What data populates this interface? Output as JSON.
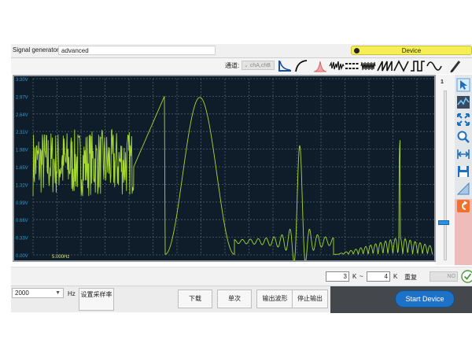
{
  "header": {
    "title": "Signal generator",
    "mode_value": "advanced",
    "device_label": "Device"
  },
  "toolbar": {
    "channel_label": "通道:",
    "channel_value": "chA,chB",
    "wave_buttons": [
      "log-curve-icon",
      "sqrt-curve-icon",
      "gaussian-pulse-icon",
      "noise-icon",
      "pulse-train-icon",
      "chirp-icon",
      "sawtooth-icon",
      "triangle-icon",
      "square-icon",
      "sine-icon",
      "pen-icon"
    ]
  },
  "plot": {
    "y_ticks": [
      "3.30V",
      "2.97V",
      "2.64V",
      "2.31V",
      "1.98V",
      "1.65V",
      "1.32V",
      "0.99V",
      "0.66V",
      "0.33V",
      "0.00V"
    ],
    "freq_label": "5.000Hz",
    "background": "#0f1d2a",
    "trace_color": "#a6d832",
    "grid_color": "#4d5e6e"
  },
  "slider": {
    "number": "1",
    "level": 0.22
  },
  "tools": [
    "pointer-icon",
    "trend-icon",
    "fit-icon",
    "zoom-icon",
    "width-icon",
    "save-icon",
    "ruler-icon",
    "undo-icon"
  ],
  "krange": {
    "from": "3",
    "to": "4",
    "unit": "K",
    "sep": "~",
    "repeat_label": "重复",
    "repeat_value": "NO"
  },
  "bottom": {
    "rate_value": "2000",
    "hz_label": "Hz",
    "set_rate_label": "设置采样率",
    "download_label": "下载",
    "single_label": "单次",
    "output_label": "输出波形",
    "stop_label": "停止输出",
    "start_label": "Start Device"
  },
  "colors": {
    "accent": "#1d72c7",
    "device_badge": "#f5ef55",
    "side_panel": "#efbcbc"
  }
}
